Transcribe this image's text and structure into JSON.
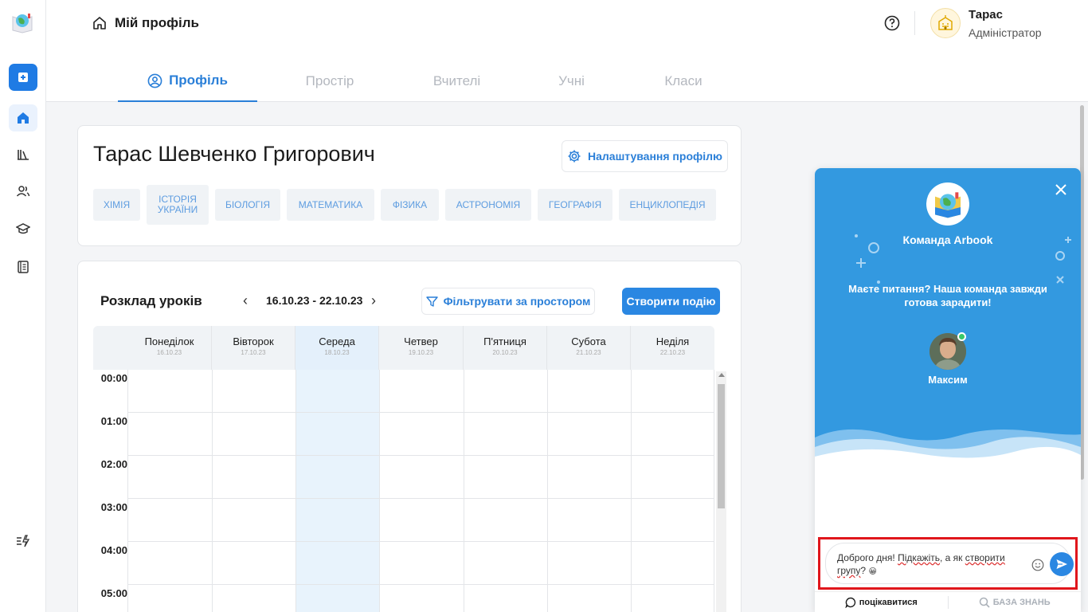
{
  "header": {
    "title": "Мій профіль",
    "user_name": "Тарас",
    "user_role": "Адміністратор"
  },
  "tabs": [
    {
      "label": "Профіль",
      "active": true
    },
    {
      "label": "Простір",
      "active": false
    },
    {
      "label": "Вчителі",
      "active": false
    },
    {
      "label": "Учні",
      "active": false
    },
    {
      "label": "Класи",
      "active": false
    }
  ],
  "profile": {
    "full_name": "Тарас Шевченко Григорович",
    "settings_label": "Налаштування профілю",
    "subjects": [
      "ХІМІЯ",
      "ІСТОРІЯ УКРАЇНИ",
      "БІОЛОГІЯ",
      "МАТЕМАТИКА",
      "ФІЗИКА",
      "АСТРОНОМІЯ",
      "ГЕОГРАФІЯ",
      "ЕНЦИКЛОПЕДІЯ"
    ]
  },
  "schedule": {
    "title": "Розклад уроків",
    "prev": "‹",
    "next": "›",
    "date_range": "16.10.23 - 22.10.23",
    "filter_label": "Фільтрувати за простором",
    "create_label": "Створити подію",
    "days": [
      {
        "name": "Понеділок",
        "date": "16.10.23"
      },
      {
        "name": "Вівторок",
        "date": "17.10.23"
      },
      {
        "name": "Середа",
        "date": "18.10.23",
        "today": true
      },
      {
        "name": "Четвер",
        "date": "19.10.23"
      },
      {
        "name": "П'ятниця",
        "date": "20.10.23"
      },
      {
        "name": "Субота",
        "date": "21.10.23"
      },
      {
        "name": "Неділя",
        "date": "22.10.23"
      }
    ],
    "hours": [
      "00:00",
      "01:00",
      "02:00",
      "03:00",
      "04:00",
      "05:00"
    ]
  },
  "chat": {
    "team_name": "Команда Arbook",
    "question": "Маєте питання? Наша команда завжди готова зарадити!",
    "agent_name": "Максим",
    "message_part1": "Доброго дня! ",
    "message_word1": "Підкажіть",
    "message_part2": ", а як ",
    "message_word2": "створити групу",
    "message_part3": "? ",
    "message_emoji": "😀",
    "footer_tab1": "поцікавитися",
    "footer_tab2": "БАЗА ЗНАНЬ"
  },
  "colors": {
    "accent": "#2a7fd8",
    "chat_bg": "#3399e0",
    "highlight": "#e0161c"
  }
}
